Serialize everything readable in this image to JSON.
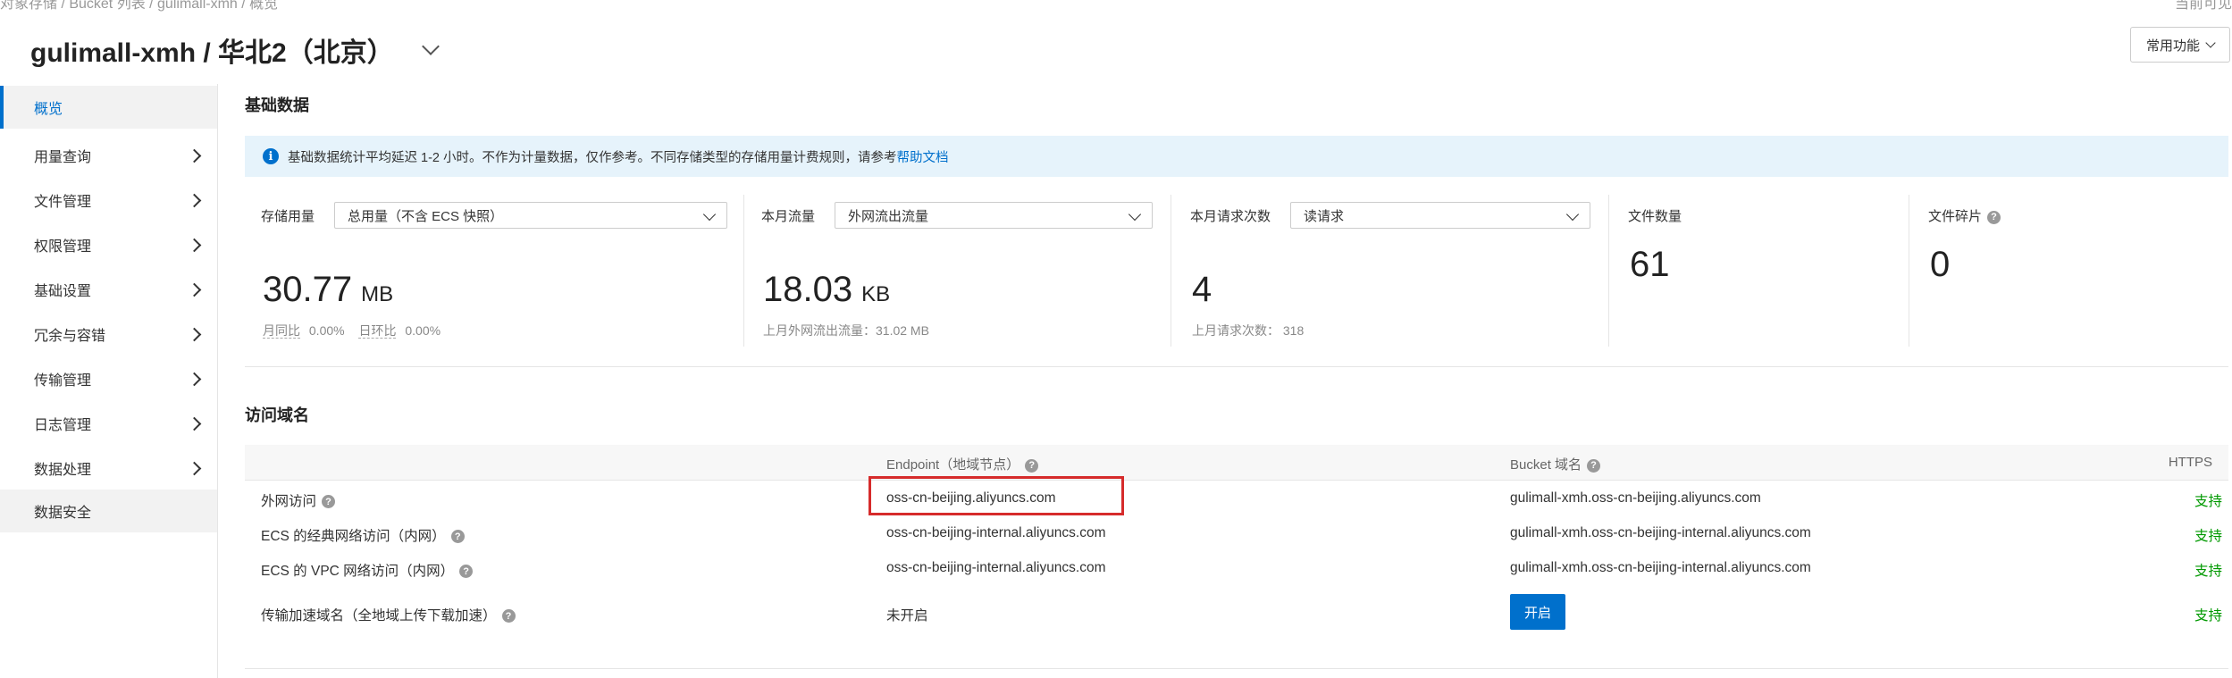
{
  "breadcrumb": "对象存储 / Bucket 列表 / gulimall-xmh / 概览",
  "top_right": "当前可见",
  "header": {
    "title": "gulimall-xmh / 华北2（北京）",
    "common_button": "常用功能"
  },
  "sidebar": {
    "items": [
      {
        "label": "概览"
      },
      {
        "label": "用量查询"
      },
      {
        "label": "文件管理"
      },
      {
        "label": "权限管理"
      },
      {
        "label": "基础设置"
      },
      {
        "label": "冗余与容错"
      },
      {
        "label": "传输管理"
      },
      {
        "label": "日志管理"
      },
      {
        "label": "数据处理"
      },
      {
        "label": "数据安全"
      }
    ]
  },
  "basic": {
    "title": "基础数据",
    "notice_text": "基础数据统计平均延迟 1-2 小时。不作为计量数据，仅作参考。不同存储类型的存储用量计费规则，请参考",
    "notice_link": "帮助文档"
  },
  "cards": {
    "storage": {
      "label": "存储用量",
      "select": "总用量（不含 ECS 快照）",
      "value": "30.77",
      "unit": "MB",
      "yoy_label": "月同比",
      "yoy": "0.00%",
      "mom_label": "日环比",
      "mom": "0.00%"
    },
    "traffic": {
      "label": "本月流量",
      "select": "外网流出流量",
      "value": "18.03",
      "unit": "KB",
      "sub": "上月外网流出流量：31.02 MB"
    },
    "requests": {
      "label": "本月请求次数",
      "select": "读请求",
      "value": "4",
      "sub": "上月请求次数：  318"
    },
    "files": {
      "label": "文件数量",
      "value": "61"
    },
    "fragments": {
      "label": "文件碎片",
      "value": "0"
    }
  },
  "domains": {
    "title": "访问域名",
    "headers": {
      "endpoint": "Endpoint（地域节点）",
      "bucket": "Bucket 域名",
      "https": "HTTPS"
    },
    "rows": [
      {
        "type": "外网访问",
        "endpoint": "oss-cn-beijing.aliyuncs.com",
        "bucket": "gulimall-xmh.oss-cn-beijing.aliyuncs.com",
        "https": "支持"
      },
      {
        "type": "ECS 的经典网络访问（内网）",
        "endpoint": "oss-cn-beijing-internal.aliyuncs.com",
        "bucket": "gulimall-xmh.oss-cn-beijing-internal.aliyuncs.com",
        "https": "支持"
      },
      {
        "type": "ECS 的 VPC 网络访问（内网）",
        "endpoint": "oss-cn-beijing-internal.aliyuncs.com",
        "bucket": "gulimall-xmh.oss-cn-beijing-internal.aliyuncs.com",
        "https": "支持"
      },
      {
        "type": "传输加速域名（全地域上传下载加速）",
        "endpoint": "未开启",
        "bucket_button": "开启",
        "https": "支持"
      }
    ]
  },
  "colors": {
    "accent": "#0070cc",
    "success": "#009900",
    "highlight": "#d62b2b"
  }
}
